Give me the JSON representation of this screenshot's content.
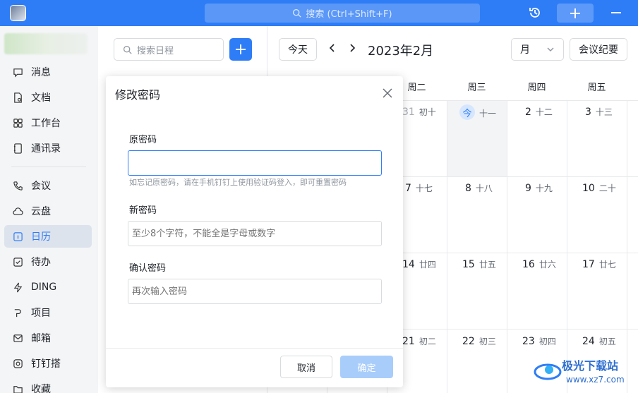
{
  "topbar": {
    "search_placeholder": "搜索 (Ctrl+Shift+F)"
  },
  "sidebar": {
    "items": [
      {
        "label": "消息"
      },
      {
        "label": "文档"
      },
      {
        "label": "工作台"
      },
      {
        "label": "通讯录"
      },
      {
        "label": "会议"
      },
      {
        "label": "云盘"
      },
      {
        "label": "日历"
      },
      {
        "label": "待办"
      },
      {
        "label": "DING"
      },
      {
        "label": "项目"
      },
      {
        "label": "邮箱"
      },
      {
        "label": "钉钉搭"
      },
      {
        "label": "收藏"
      }
    ],
    "active": "日历"
  },
  "calendar": {
    "search_placeholder": "搜索日程",
    "today_button": "今天",
    "month_title": "2023年2月",
    "view_select": "月",
    "minutes_button": "会议纪要",
    "weekdays": [
      "周二",
      "周三",
      "周四",
      "周五"
    ],
    "rows": [
      [
        {
          "d": "31",
          "l": "初十",
          "faded": true
        },
        {
          "d": "今",
          "l": "十一",
          "today": true
        },
        {
          "d": "2",
          "l": "十二"
        },
        {
          "d": "3",
          "l": "十三"
        }
      ],
      [
        {
          "d": "7",
          "l": "十七"
        },
        {
          "d": "8",
          "l": "十八"
        },
        {
          "d": "9",
          "l": "十九"
        },
        {
          "d": "10",
          "l": "二十"
        }
      ],
      [
        {
          "d": "14",
          "l": "廿四"
        },
        {
          "d": "15",
          "l": "廿五"
        },
        {
          "d": "16",
          "l": "廿六"
        },
        {
          "d": "17",
          "l": "廿七"
        }
      ],
      [
        {
          "d": "21",
          "l": "初二"
        },
        {
          "d": "22",
          "l": "初三"
        },
        {
          "d": "23",
          "l": "初四"
        },
        {
          "d": "24",
          "l": "初五"
        }
      ]
    ]
  },
  "dialog": {
    "title": "修改密码",
    "old_password_label": "原密码",
    "old_password_value": "",
    "hint": "如忘记原密码，请在手机钉钉上使用验证码登入，即可重置密码",
    "new_password_label": "新密码",
    "new_password_placeholder": "至少8个字符，不能全是字母或数字",
    "confirm_label": "确认密码",
    "confirm_placeholder": "再次输入密码",
    "cancel": "取消",
    "confirm": "确定"
  },
  "watermark": {
    "title": "极光下载站",
    "url": "www.xz7.com"
  },
  "colors": {
    "accent": "#2f7df6",
    "topbar": "#2f7df6",
    "confirm_disabled": "#a9cdfb"
  }
}
